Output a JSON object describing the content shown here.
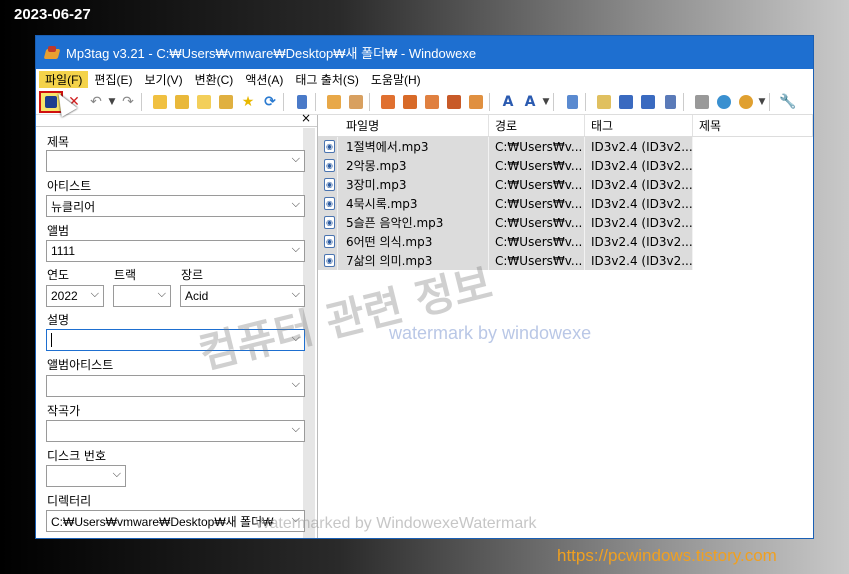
{
  "date_stamp": "2023-06-27",
  "site_url": "https://pcwindows.tistory.com",
  "window": {
    "title": "Mp3tag v3.21  -  C:₩Users₩vmware₩Desktop₩새 폴더₩  - Windowexe"
  },
  "menu": [
    "파일(F)",
    "편집(E)",
    "보기(V)",
    "변환(C)",
    "액션(A)",
    "태그 출처(S)",
    "도움말(H)"
  ],
  "toolbar_icons": [
    "save-icon",
    "remove-tag-icon",
    "undo-icon",
    "redo-icon",
    "folder-open-icon",
    "add-folder-icon",
    "favorite-folder-icon",
    "star-icon",
    "refresh-icon"
  ],
  "fields": {
    "title_label": "제목",
    "title_value": "",
    "artist_label": "아티스트",
    "artist_value": "뉴클리어",
    "album_label": "앨범",
    "album_value": "1111",
    "year_label": "연도",
    "year_value": "2022",
    "track_label": "트랙",
    "track_value": "",
    "genre_label": "장르",
    "genre_value": "Acid",
    "comment_label": "설명",
    "comment_value": "",
    "album_artist_label": "앨범아티스트",
    "album_artist_value": "",
    "composer_label": "작곡가",
    "composer_value": "",
    "disc_label": "디스크 번호",
    "disc_value": "",
    "directory_label": "디렉터리",
    "directory_value": "C:₩Users₩vmware₩Desktop₩새 폴더₩"
  },
  "columns": [
    "파일명",
    "경로",
    "태그",
    "제목"
  ],
  "files": [
    {
      "name": "1절벽에서.mp3",
      "path": "C:₩Users₩v...",
      "tag": "ID3v2.4 (ID3v2....",
      "title": ""
    },
    {
      "name": "2악몽.mp3",
      "path": "C:₩Users₩v...",
      "tag": "ID3v2.4 (ID3v2....",
      "title": ""
    },
    {
      "name": "3장미.mp3",
      "path": "C:₩Users₩v...",
      "tag": "ID3v2.4 (ID3v2....",
      "title": ""
    },
    {
      "name": "4묵시록.mp3",
      "path": "C:₩Users₩v...",
      "tag": "ID3v2.4 (ID3v2....",
      "title": ""
    },
    {
      "name": "5슬픈 음악인.mp3",
      "path": "C:₩Users₩v...",
      "tag": "ID3v2.4 (ID3v2....",
      "title": ""
    },
    {
      "name": "6어떤 의식.mp3",
      "path": "C:₩Users₩v...",
      "tag": "ID3v2.4 (ID3v2....",
      "title": ""
    },
    {
      "name": "7삶의 의미.mp3",
      "path": "C:₩Users₩v...",
      "tag": "ID3v2.4 (ID3v2....",
      "title": ""
    }
  ],
  "watermarks": {
    "korean": "컴퓨터 관련 정보",
    "blue": "watermark by windowexe",
    "bottom": "Watermarked by WindowexeWatermark"
  },
  "colors": {
    "titlebar": "#1e6fd0",
    "menu_active": "#f4d34a",
    "row_selected": "#dcdcdc",
    "url": "#f0a020"
  }
}
